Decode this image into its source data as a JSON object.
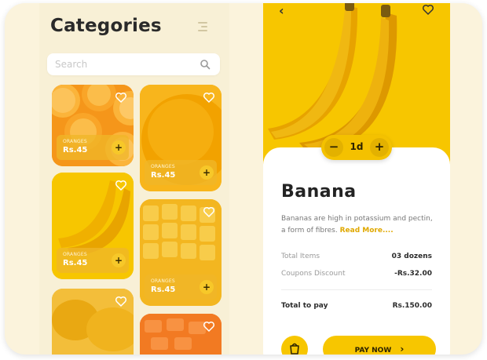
{
  "left_screen": {
    "title": "Categories",
    "search": {
      "placeholder": "Search"
    },
    "products": [
      {
        "name": "ORANGES",
        "price": "Rs.45"
      },
      {
        "name": "ORANGES",
        "price": "Rs.45"
      },
      {
        "name": "ORANGES",
        "price": "Rs.45"
      },
      {
        "name": "ORANGES",
        "price": "Rs.45"
      }
    ],
    "add_symbol": "+"
  },
  "right_screen": {
    "back_symbol": "‹",
    "quantity": {
      "minus": "−",
      "value": "1d",
      "plus": "+"
    },
    "product": {
      "name": "Banana",
      "description": "Bananas are high in potassium and pectin, a form of fibres.",
      "read_more": "Read More...."
    },
    "summary": {
      "total_items_label": "Total Items",
      "total_items_value": "03 dozens",
      "coupons_label": "Coupons Discount",
      "coupons_value": "-Rs.32.00",
      "total_label": "Total to pay",
      "total_value": "Rs.150.00"
    },
    "pay_button": "PAY NOW",
    "pay_chevron": "›"
  },
  "colors": {
    "accent": "#f7c600",
    "background": "#fbf3dc",
    "text_dark": "#232323",
    "link": "#e0a800"
  },
  "icons": [
    "menu-icon",
    "search-icon",
    "heart-icon",
    "back-icon",
    "cart-icon",
    "chevron-right-icon"
  ]
}
